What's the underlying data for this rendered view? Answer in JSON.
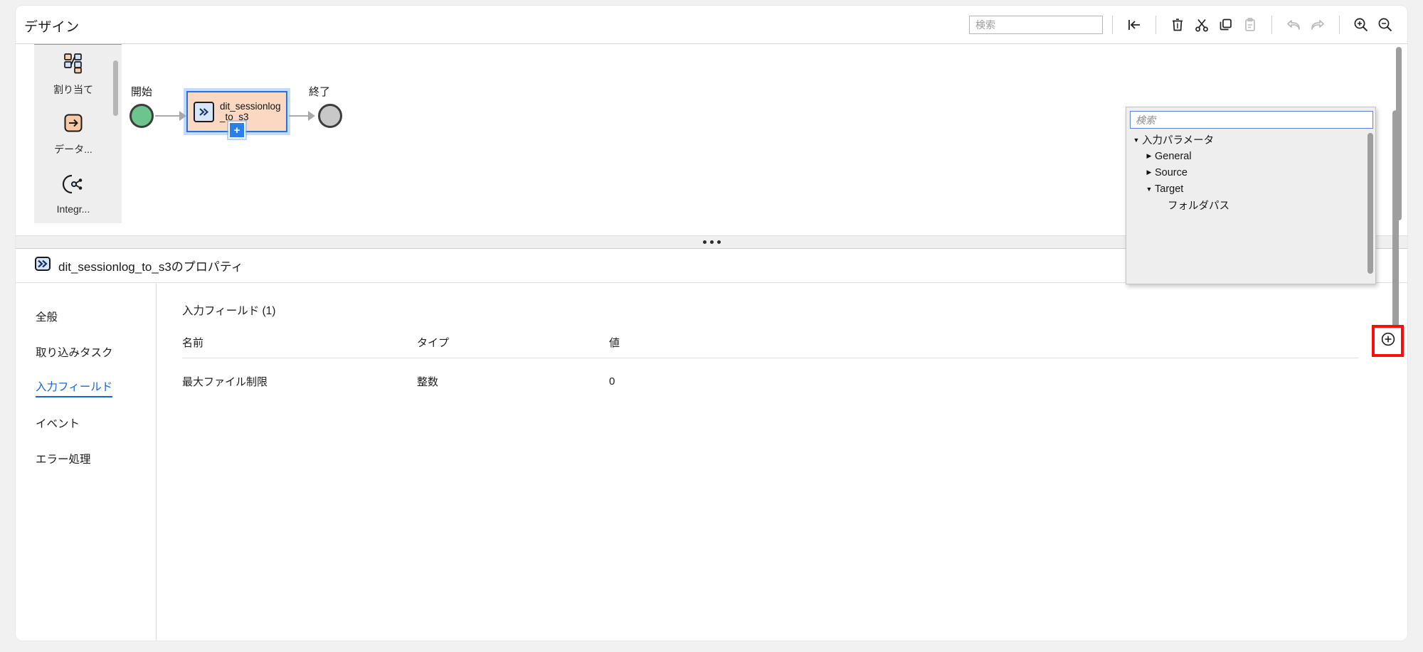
{
  "header": {
    "title": "デザイン",
    "search": {
      "placeholder": "検索",
      "value": ""
    },
    "tools": [
      {
        "name": "collapse-left-icon",
        "label": "|←"
      },
      {
        "name": "delete-icon",
        "label": "削除"
      },
      {
        "name": "cut-icon",
        "label": "切り取り"
      },
      {
        "name": "copy-icon",
        "label": "コピー"
      },
      {
        "name": "paste-icon",
        "label": "貼り付け"
      },
      {
        "name": "undo-icon",
        "label": "元に戻す"
      },
      {
        "name": "redo-icon",
        "label": "やり直し"
      },
      {
        "name": "zoom-in-icon",
        "label": "拡大"
      },
      {
        "name": "zoom-out-icon",
        "label": "縮小"
      }
    ]
  },
  "palette": {
    "items": [
      {
        "label": "割り当て",
        "icon": "assignment-icon"
      },
      {
        "label": "データ...",
        "icon": "data-task-icon"
      },
      {
        "label": "Integr...",
        "icon": "integration-icon"
      }
    ]
  },
  "canvas": {
    "start_label": "開始",
    "end_label": "終了",
    "task": {
      "name": "dit_sessionlog_to_s3",
      "icon": "task-chevron-icon",
      "add_button": "+"
    }
  },
  "properties": {
    "title": "dit_sessionlog_to_s3のプロパティ",
    "icon": "task-chevron-icon",
    "tabs": [
      {
        "label": "全般",
        "active": false
      },
      {
        "label": "取り込みタスク",
        "active": false
      },
      {
        "label": "入力フィールド",
        "active": true
      },
      {
        "label": "イベント",
        "active": false
      },
      {
        "label": "エラー処理",
        "active": false
      }
    ],
    "section_title": "入力フィールド (1)",
    "table": {
      "columns": [
        "名前",
        "タイプ",
        "値"
      ],
      "rows": [
        {
          "name": "最大ファイル制限",
          "type": "整数",
          "value": "0"
        }
      ]
    }
  },
  "tree_popup": {
    "search": {
      "placeholder": "検索",
      "value": ""
    },
    "nodes": [
      {
        "label": "入力パラメータ",
        "level": 1,
        "caret": "▼"
      },
      {
        "label": "General",
        "level": 2,
        "caret": "▶"
      },
      {
        "label": "Source",
        "level": 2,
        "caret": "▶"
      },
      {
        "label": "Target",
        "level": 2,
        "caret": "▼"
      },
      {
        "label": "フォルダパス",
        "level": 3,
        "caret": ""
      }
    ]
  },
  "add_button": {
    "icon": "plus-circle-icon",
    "highlight_color": "#fc0d0d"
  }
}
